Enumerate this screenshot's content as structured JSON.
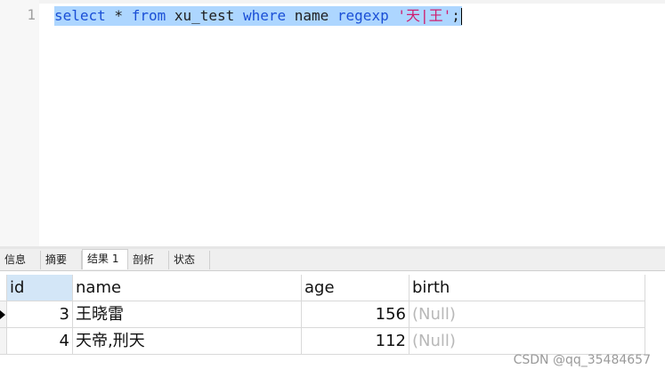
{
  "editor": {
    "line_number": "1",
    "tokens": {
      "select": "select",
      "star": " * ",
      "from": "from",
      "table": " xu_test ",
      "where": "where",
      "column": " name ",
      "regexp": "regexp",
      "space": " ",
      "pattern": "'天|王'",
      "semicolon": ";"
    }
  },
  "tabs": [
    {
      "label": "信息"
    },
    {
      "label": "摘要"
    },
    {
      "label": "结果 1",
      "active": true
    },
    {
      "label": "剖析"
    },
    {
      "label": "状态"
    }
  ],
  "grid": {
    "columns": [
      "id",
      "name",
      "age",
      "birth"
    ],
    "rows": [
      {
        "id": "3",
        "name": "王晓雷",
        "age": "156",
        "birth": "(Null)",
        "current": true
      },
      {
        "id": "4",
        "name": "天帝,刑天",
        "age": "112",
        "birth": "(Null)"
      }
    ]
  },
  "watermark": "CSDN @qq_35484657",
  "colors": {
    "keyword": "#1a4fd6",
    "string": "#d01e6e",
    "selection": "#add6ff",
    "null_text": "#b8b8b8",
    "header_selected": "#d3e6f7"
  }
}
